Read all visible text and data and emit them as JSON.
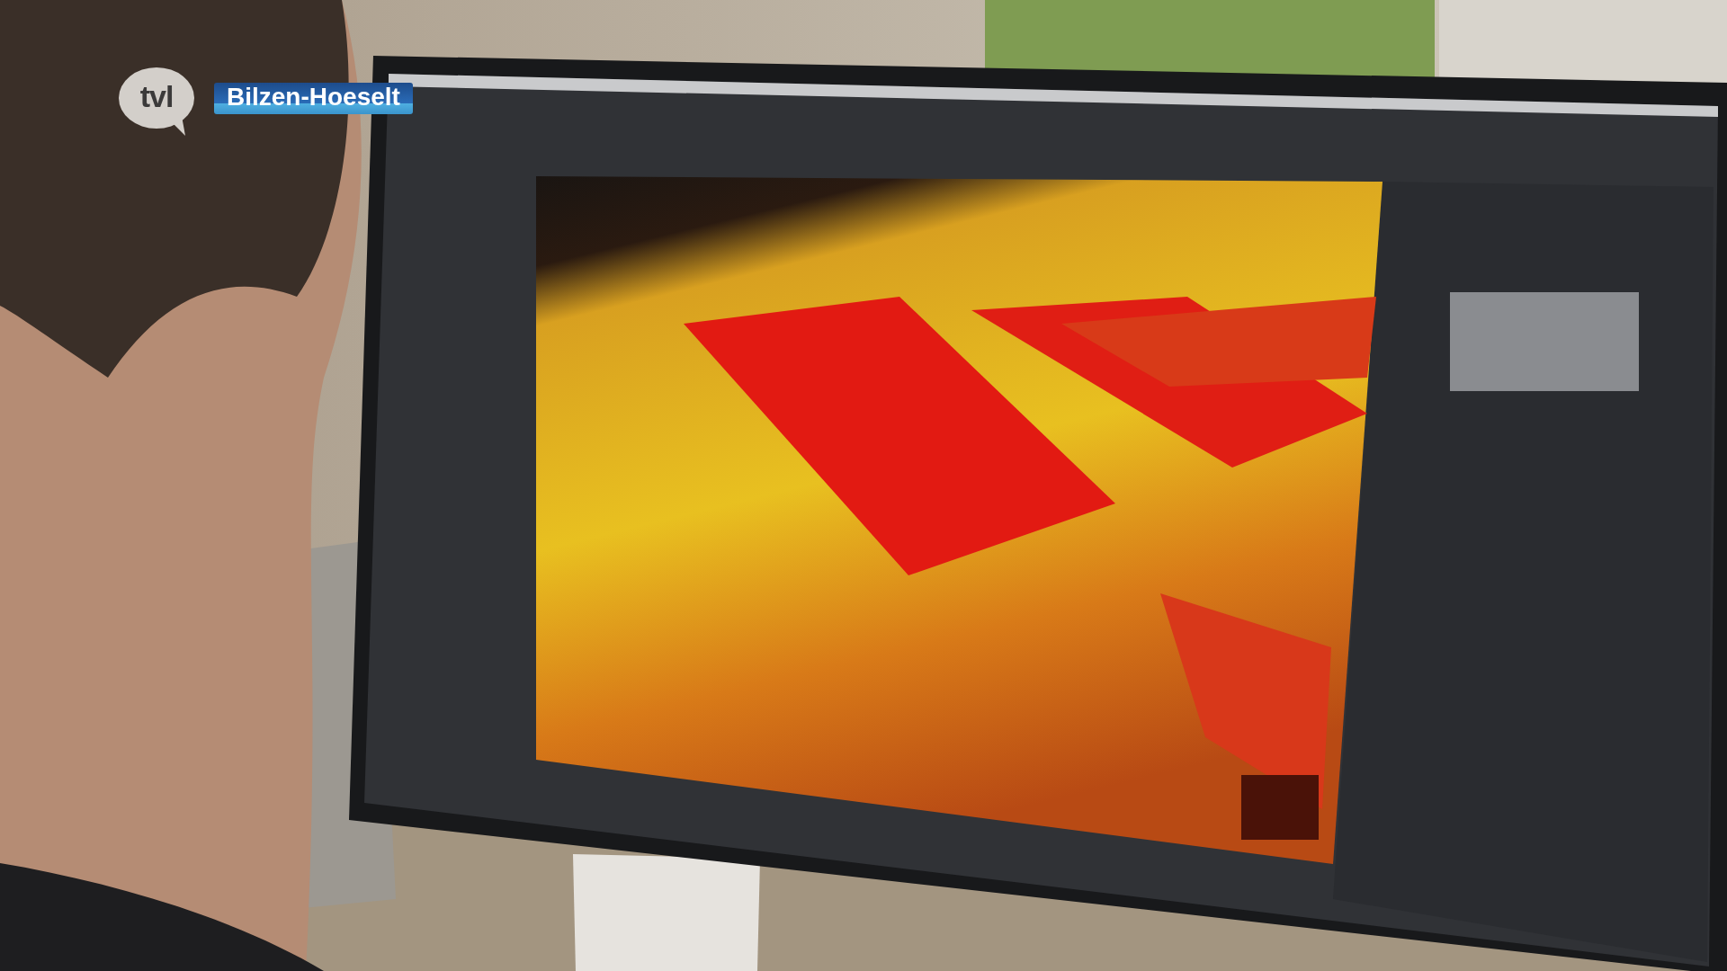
{
  "overlay": {
    "channel_logo": "tvl",
    "location": "Bilzen-Hoeselt"
  }
}
